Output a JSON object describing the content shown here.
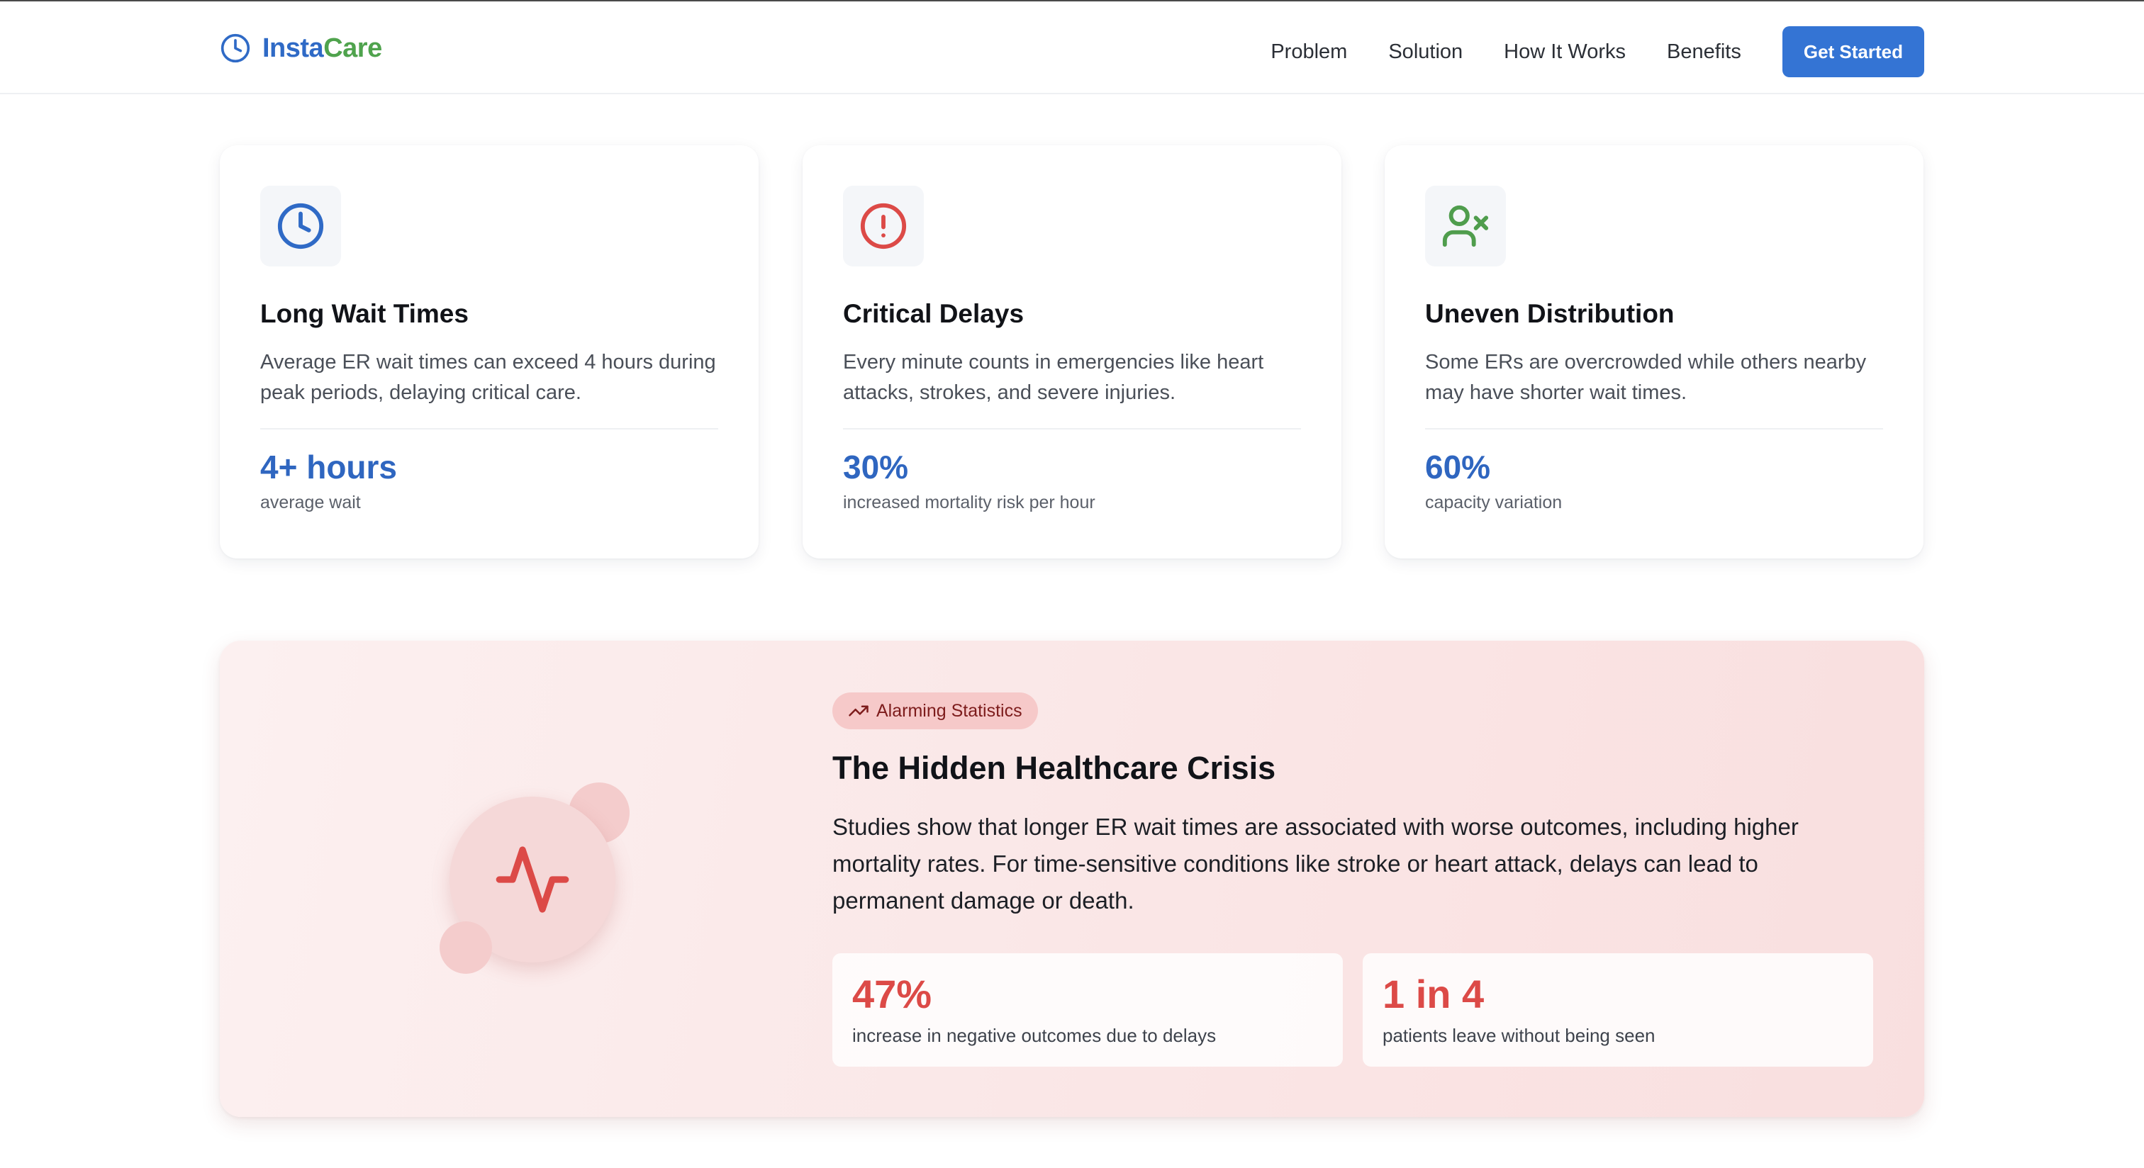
{
  "header": {
    "logo": {
      "part1": "Insta",
      "part2": "Care",
      "icon": "clock-icon"
    },
    "nav": [
      "Problem",
      "Solution",
      "How It Works",
      "Benefits"
    ],
    "cta_label": "Get Started"
  },
  "cards": [
    {
      "icon": "clock-icon",
      "title": "Long Wait Times",
      "description": "Average ER wait times can exceed 4 hours during peak periods, delaying critical care.",
      "stat_value": "4+ hours",
      "stat_label": "average wait"
    },
    {
      "icon": "alert-circle-icon",
      "title": "Critical Delays",
      "description": "Every minute counts in emergencies like heart attacks, strokes, and severe injuries.",
      "stat_value": "30%",
      "stat_label": "increased mortality risk per hour"
    },
    {
      "icon": "user-x-icon",
      "title": "Uneven Distribution",
      "description": "Some ERs are overcrowded while others nearby may have shorter wait times.",
      "stat_value": "60%",
      "stat_label": "capacity variation"
    }
  ],
  "crisis": {
    "badge_icon": "trending-up-icon",
    "badge_label": "Alarming Statistics",
    "visual_icon": "activity-icon",
    "title": "The Hidden Healthcare Crisis",
    "body": "Studies show that longer ER wait times are associated with worse outcomes, including higher mortality rates. For time-sensitive conditions like stroke or heart attack, delays can lead to permanent damage or death.",
    "stats": [
      {
        "value": "47%",
        "label": "increase in negative outcomes due to delays"
      },
      {
        "value": "1 in 4",
        "label": "patients leave without being seen"
      }
    ]
  },
  "colors": {
    "brand_blue": "#2f6ac6",
    "brand_green": "#4fa34d",
    "cta_blue": "#3474d4",
    "alert_red": "#dc4a47",
    "user_green": "#4f9d4d"
  }
}
